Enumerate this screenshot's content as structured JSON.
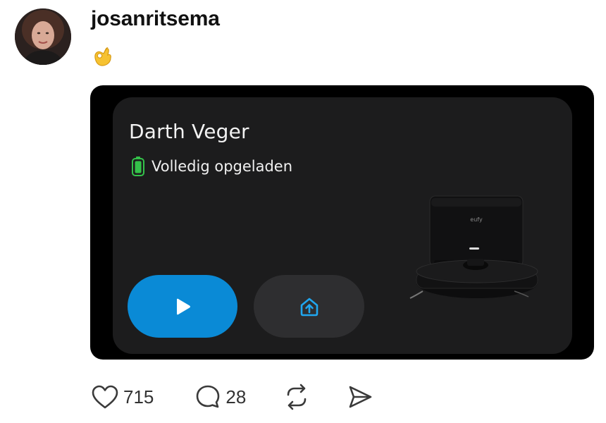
{
  "post": {
    "username": "josanritsema",
    "text_emoji": "ok-hand-emoji"
  },
  "card": {
    "device_name": "Darth Veger",
    "status": "Volledig opgeladen",
    "robot_logo": "eufy",
    "colors": {
      "primary": "#0a8ad6",
      "battery": "#34c24a",
      "card_bg": "#1c1c1d"
    }
  },
  "actions": {
    "likes": "715",
    "comments": "28"
  },
  "icons": [
    "heart-icon",
    "comment-icon",
    "repost-icon",
    "send-icon",
    "play-icon",
    "dock-home-icon",
    "battery-icon"
  ]
}
